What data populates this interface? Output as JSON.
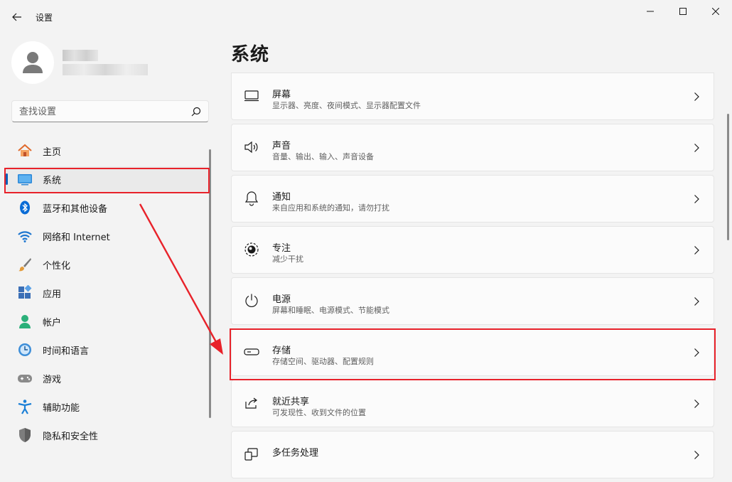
{
  "window": {
    "title": "设置"
  },
  "search": {
    "placeholder": "查找设置"
  },
  "nav": [
    {
      "label": "主页",
      "icon": "home-icon"
    },
    {
      "label": "系统",
      "icon": "system-icon",
      "selected": true
    },
    {
      "label": "蓝牙和其他设备",
      "icon": "bluetooth-icon"
    },
    {
      "label": "网络和 Internet",
      "icon": "wifi-icon"
    },
    {
      "label": "个性化",
      "icon": "brush-icon"
    },
    {
      "label": "应用",
      "icon": "apps-icon"
    },
    {
      "label": "帐户",
      "icon": "account-icon"
    },
    {
      "label": "时间和语言",
      "icon": "time-language-icon"
    },
    {
      "label": "游戏",
      "icon": "gamepad-icon"
    },
    {
      "label": "辅助功能",
      "icon": "accessibility-icon"
    },
    {
      "label": "隐私和安全性",
      "icon": "shield-icon"
    }
  ],
  "page": {
    "title": "系统"
  },
  "cards": [
    {
      "title": "屏幕",
      "subtitle": "显示器、亮度、夜间模式、显示器配置文件",
      "icon": "display-icon"
    },
    {
      "title": "声音",
      "subtitle": "音量、输出、输入、声音设备",
      "icon": "speaker-icon"
    },
    {
      "title": "通知",
      "subtitle": "来自应用和系统的通知，请勿打扰",
      "icon": "bell-icon"
    },
    {
      "title": "专注",
      "subtitle": "减少干扰",
      "icon": "focus-icon"
    },
    {
      "title": "电源",
      "subtitle": "屏幕和睡眠、电源模式、节能模式",
      "icon": "power-icon"
    },
    {
      "title": "存储",
      "subtitle": "存储空间、驱动器、配置规则",
      "icon": "storage-icon"
    },
    {
      "title": "就近共享",
      "subtitle": "可发现性、收到文件的位置",
      "icon": "share-icon"
    },
    {
      "title": "多任务处理",
      "subtitle": "",
      "icon": "multitask-icon"
    }
  ],
  "colors": {
    "accent": "#005fb8",
    "highlight": "#e8222a",
    "background": "#f3f3f3",
    "card": "#fbfbfb"
  }
}
